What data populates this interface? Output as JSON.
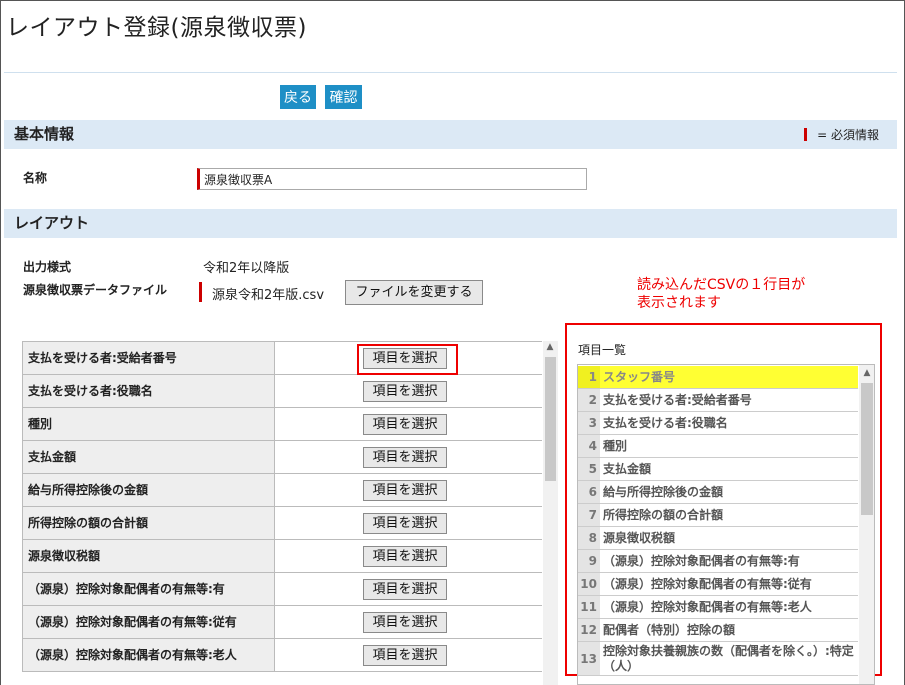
{
  "page": {
    "title": "レイアウト登録(源泉徴収票)"
  },
  "toolbar": {
    "back_label": "戻る",
    "confirm_label": "確認"
  },
  "basic": {
    "section_title": "基本情報",
    "required_note": "= 必須情報",
    "name_label": "名称",
    "name_value": "源泉徴収票A"
  },
  "layout": {
    "section_title": "レイアウト",
    "output_style_label": "出力様式",
    "output_style_value": "令和2年以降版",
    "file_label": "源泉徴収票データファイル",
    "file_value": "源泉令和2年版.csv",
    "change_file_label": "ファイルを変更する"
  },
  "annotation": {
    "line1": "読み込んだCSVの１行目が",
    "line2": "表示されます"
  },
  "mapping_rows": [
    {
      "label": "支払を受ける者:受給者番号",
      "button": "項目を選択"
    },
    {
      "label": "支払を受ける者:役職名",
      "button": "項目を選択"
    },
    {
      "label": "種別",
      "button": "項目を選択"
    },
    {
      "label": "支払金額",
      "button": "項目を選択"
    },
    {
      "label": "給与所得控除後の金額",
      "button": "項目を選択"
    },
    {
      "label": "所得控除の額の合計額",
      "button": "項目を選択"
    },
    {
      "label": "源泉徴収税額",
      "button": "項目を選択"
    },
    {
      "label": "（源泉）控除対象配偶者の有無等:有",
      "button": "項目を選択"
    },
    {
      "label": "（源泉）控除対象配偶者の有無等:従有",
      "button": "項目を選択"
    },
    {
      "label": "（源泉）控除対象配偶者の有無等:老人",
      "button": "項目を選択"
    }
  ],
  "item_list": {
    "title": "項目一覧",
    "items": [
      {
        "num": "1",
        "text": "スタッフ番号"
      },
      {
        "num": "2",
        "text": "支払を受ける者:受給者番号"
      },
      {
        "num": "3",
        "text": "支払を受ける者:役職名"
      },
      {
        "num": "4",
        "text": "種別"
      },
      {
        "num": "5",
        "text": "支払金額"
      },
      {
        "num": "6",
        "text": "給与所得控除後の金額"
      },
      {
        "num": "7",
        "text": "所得控除の額の合計額"
      },
      {
        "num": "8",
        "text": "源泉徴収税額"
      },
      {
        "num": "9",
        "text": "（源泉）控除対象配偶者の有無等:有"
      },
      {
        "num": "10",
        "text": "（源泉）控除対象配偶者の有無等:従有"
      },
      {
        "num": "11",
        "text": "（源泉）控除対象配偶者の有無等:老人"
      },
      {
        "num": "12",
        "text": "配偶者（特別）控除の額"
      },
      {
        "num": "13",
        "text": "控除対象扶養親族の数（配偶者を除く。）:特定（人）"
      }
    ]
  },
  "colors": {
    "accent_button": "#1e8fc6",
    "section_bg": "#dce9f5",
    "required": "#cc0000",
    "highlight": "#ffff33",
    "annotation": "#ee0000"
  }
}
